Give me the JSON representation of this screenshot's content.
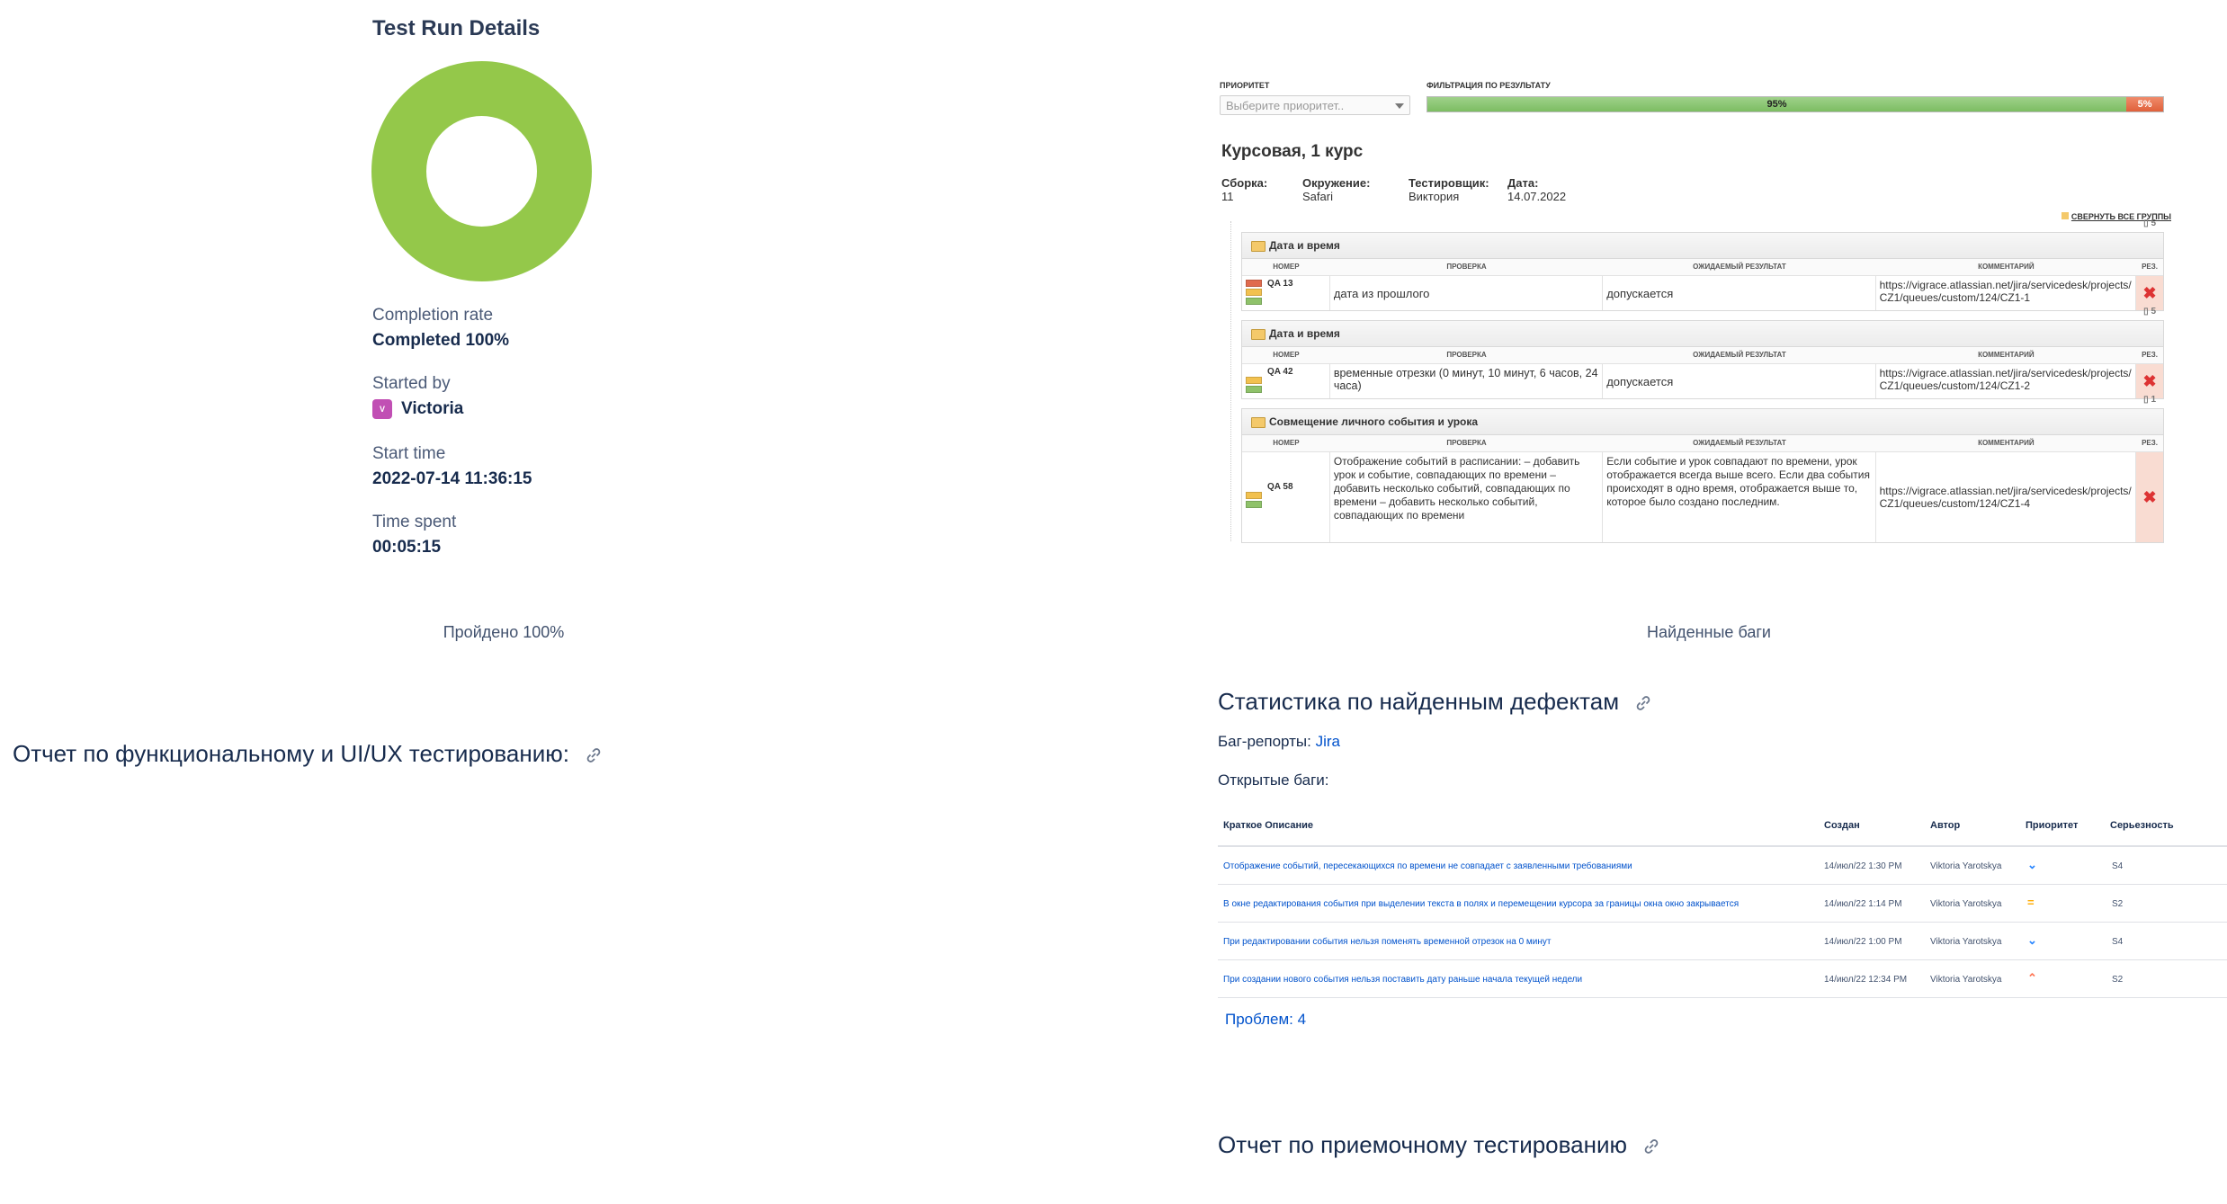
{
  "test_run": {
    "title": "Test Run Details",
    "completion_label": "Completion rate",
    "completion_value": "Completed 100%",
    "completion_fraction": 1.0,
    "started_by_label": "Started by",
    "started_by_initials": "V",
    "started_by_value": "Victoria",
    "start_time_label": "Start time",
    "start_time_value": "2022-07-14 11:36:15",
    "time_spent_label": "Time spent",
    "time_spent_value": "00:05:15",
    "donut_color": "#94c84a"
  },
  "captions": {
    "left": "Пройдено 100%",
    "right": "Найденные баги"
  },
  "testrail": {
    "priority_label": "ПРИОРИТЕТ",
    "priority_placeholder": "Выберите приоритет..",
    "filter_label": "ФИЛЬТРАЦИЯ ПО РЕЗУЛЬТАТУ",
    "passed_pct": "95%",
    "failed_pct": "5%",
    "passed_fraction": 0.95,
    "run_title": "Курсовая, 1 курс",
    "meta": [
      {
        "label": "Сборка:",
        "value": "11"
      },
      {
        "label": "Окружение:",
        "value": "Safari"
      },
      {
        "label": "Тестировщик:",
        "value": "Виктория"
      },
      {
        "label": "Дата:",
        "value": "14.07.2022"
      }
    ],
    "collapse_all": "СВЕРНУТЬ ВСЕ ГРУППЫ",
    "columns": [
      "НОМЕР",
      "ПРОВЕРКА",
      "ОЖИДАЕМЫЙ РЕЗУЛЬТАТ",
      "КОММЕНТАРИЙ",
      "РЕЗ."
    ],
    "groups": [
      {
        "name": "Дата и время",
        "count": "5",
        "id": "QA 13",
        "check": "дата из прошлого",
        "expected": "допускается",
        "comment": "https://vigrace.atlassian.net/jira/servicedesk/projects/CZ1/queues/custom/124/CZ1-1",
        "result_icon": "x-icon"
      },
      {
        "name": "Дата и время",
        "count": "5",
        "id": "QA 42",
        "check": "временные отрезки (0 минут, 10 минут, 6 часов, 24 часа)",
        "expected": "допускается",
        "comment": "https://vigrace.atlassian.net/jira/servicedesk/projects/CZ1/queues/custom/124/CZ1-2",
        "result_icon": "x-icon"
      },
      {
        "name": "Совмещение личного события и урока",
        "count": "1",
        "id": "QA 58",
        "check": "Отображение событий в расписании: – добавить урок и событие, совпадающих по времени – добавить несколько событий, совпадающих по времени – добавить несколько событий, совпадающих по времени",
        "expected": "Если событие и урок совпадают по времени, урок отображается всегда выше всего. Если два события происходят в одно время, отображается выше то, которое было создано последним.",
        "comment": "https://vigrace.atlassian.net/jira/servicedesk/projects/CZ1/queues/custom/124/CZ1-4",
        "result_icon": "x-icon"
      }
    ]
  },
  "defects": {
    "heading": "Статистика по найденным дефектам",
    "bug_reports_label": "Баг-репорты:",
    "bug_reports_link": "Jira",
    "open_bugs_label": "Открытые баги:",
    "columns": [
      "Краткое Описание",
      "Создан",
      "Автор",
      "Приоритет",
      "Серьезность"
    ],
    "rows": [
      {
        "summary": "Отображение событий, пересекающихся по времени не совпадает с заявленными требованиями",
        "created": "14/июл/22 1:30 PM",
        "author": "Viktoria Yarotskya",
        "priority_icon": "chevron-down-icon",
        "priority_glyph": "⌄",
        "priority_color": "#2684ff",
        "severity": "S4"
      },
      {
        "summary": "В окне редактирования события при выделении текста в полях и перемещении курсора за границы окна окно закрывается",
        "created": "14/июл/22 1:14 PM",
        "author": "Viktoria Yarotskya",
        "priority_icon": "equals-icon",
        "priority_glyph": "=",
        "priority_color": "#ffab00",
        "severity": "S2"
      },
      {
        "summary": "При редактировании события нельзя поменять временной отрезок на 0 минут",
        "created": "14/июл/22 1:00 PM",
        "author": "Viktoria Yarotskya",
        "priority_icon": "chevron-down-icon",
        "priority_glyph": "⌄",
        "priority_color": "#2684ff",
        "severity": "S4"
      },
      {
        "summary": "При создании нового события нельзя поставить дату раньше начала текущей недели",
        "created": "14/июл/22 12:34 PM",
        "author": "Viktoria Yarotskya",
        "priority_icon": "chevron-up-icon",
        "priority_glyph": "⌃",
        "priority_color": "#ff7452",
        "severity": "S2"
      }
    ],
    "total": "Проблем: 4"
  },
  "sections": {
    "functional_report": "Отчет по функциональному и UI/UX тестированию:",
    "acceptance_report": "Отчет по приемочному тестированию"
  }
}
